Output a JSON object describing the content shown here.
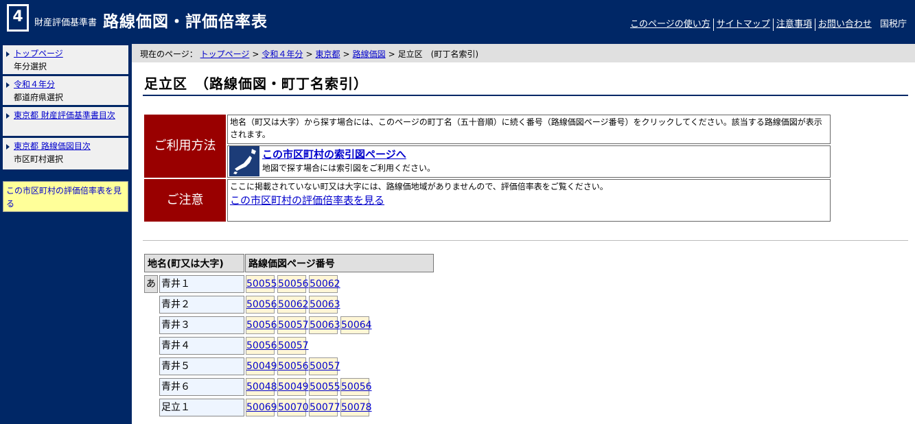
{
  "header": {
    "logo_number": "4",
    "site_sub": "財産評価基準書",
    "site_main": "路線価図・評価倍率表",
    "links": [
      "このページの使い方",
      "サイトマップ",
      "注意事項",
      "お問い合わせ"
    ],
    "agency": "国税庁"
  },
  "sidebar": {
    "items": [
      {
        "link": "トップページ",
        "sub": "年分選択"
      },
      {
        "link": "令和４年分",
        "sub": "都道府県選択"
      },
      {
        "link": "東京都 財産評価基準書目次",
        "sub": ""
      },
      {
        "link": "東京都 路線価図目次",
        "sub": "市区町村選択"
      }
    ],
    "note": "この市区町村の評価倍率表を見る"
  },
  "breadcrumb": {
    "label": "現在のページ：",
    "items": [
      "トップページ",
      "令和４年分",
      "東京都",
      "路線価図"
    ],
    "current": "足立区　(町丁名索引)"
  },
  "page_title": "足立区　（路線価図・町丁名索引）",
  "usage": {
    "heading": "ご利用方法",
    "text": "地名（町又は大字）から探す場合には、このページの町丁名（五十音順）に続く番号（路線価図ページ番号）をクリックしてください。該当する路線価図が表示されます。",
    "map_link": "この市区町村の索引図ページへ",
    "map_text": "地図で探す場合には索引図をご利用ください。"
  },
  "caution": {
    "heading": "ご注意",
    "text": "ここに掲載されていない町又は大字には、路線価地域がありませんので、評価倍率表をご覧ください。",
    "link": "この市区町村の評価倍率表を見る"
  },
  "index_table": {
    "col_name": "地名(町又は大字)",
    "col_pages": "路線価図ページ番号",
    "kana": "あ",
    "rows": [
      {
        "name": "青井１",
        "pages": [
          "50055",
          "50056",
          "50062"
        ]
      },
      {
        "name": "青井２",
        "pages": [
          "50056",
          "50062",
          "50063"
        ]
      },
      {
        "name": "青井３",
        "pages": [
          "50056",
          "50057",
          "50063",
          "50064"
        ]
      },
      {
        "name": "青井４",
        "pages": [
          "50056",
          "50057"
        ]
      },
      {
        "name": "青井５",
        "pages": [
          "50049",
          "50056",
          "50057"
        ]
      },
      {
        "name": "青井６",
        "pages": [
          "50048",
          "50049",
          "50055",
          "50056"
        ]
      },
      {
        "name": "足立１",
        "pages": [
          "50069",
          "50070",
          "50077",
          "50078"
        ]
      }
    ]
  },
  "colors": {
    "header_bg": "#002766",
    "red_head": "#990000",
    "note_bg": "#ffff99"
  }
}
